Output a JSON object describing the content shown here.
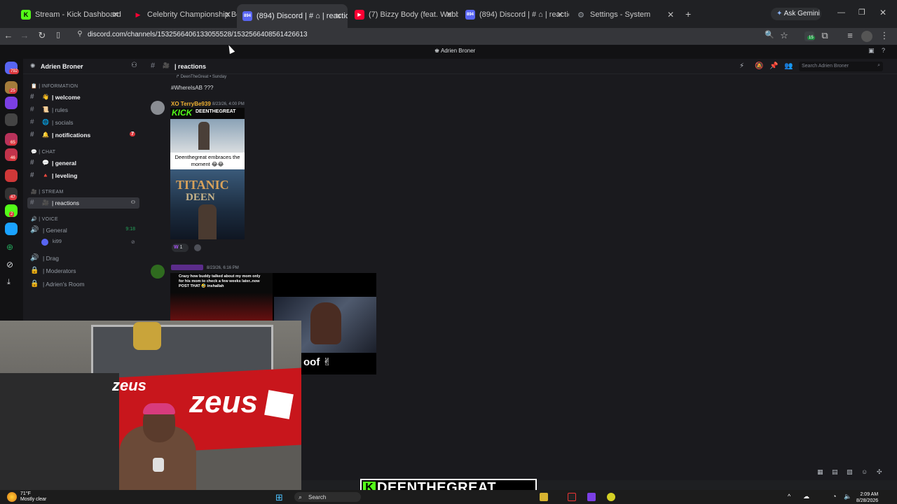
{
  "browser": {
    "tabs": [
      {
        "label": "Stream - Kick Dashboard",
        "favicon": "K",
        "color": "#53fc18"
      },
      {
        "label": "Celebrity Championship Box",
        "favicon": "▶",
        "color": "#ff0033"
      },
      {
        "label": "(894) Discord | # ⌂ | reactions",
        "favicon": "894",
        "color": "#5865f2"
      },
      {
        "label": "(7) Bizzy Body (feat. Webbie &",
        "favicon": "▶",
        "color": "#ff0033"
      },
      {
        "label": "(894) Discord | # ⌂ | reactions",
        "favicon": "894",
        "color": "#5865f2"
      },
      {
        "label": "Settings - System",
        "favicon": "⚙",
        "color": "#9aa0a6"
      }
    ],
    "ask_gemini": "Ask Gemini",
    "url": "discord.com/channels/1532566406133055528/1532566408561426613",
    "extension_badge": "15"
  },
  "discord": {
    "guild_banner": "Adrien Broner",
    "server_name": "Adrien Broner",
    "server_rail_badges": [
      "792",
      "25",
      "65",
      "46",
      "47",
      "2"
    ],
    "categories": {
      "information": "| INFORMATION",
      "chat": "| CHAT",
      "stream": "| STREAM",
      "voice": "| VOICE"
    },
    "channels": [
      {
        "emoji": "👋",
        "label": "| welcome",
        "bright": true
      },
      {
        "emoji": "📜",
        "label": "| rules",
        "bright": false
      },
      {
        "emoji": "🌐",
        "label": "| socials",
        "bright": false
      },
      {
        "emoji": "🔔",
        "label": "| notifications",
        "bright": true,
        "badge": "7"
      },
      {
        "emoji": "💬",
        "label": "| general",
        "bright": true
      },
      {
        "emoji": "🔺",
        "label": "| leveling",
        "bright": true
      },
      {
        "emoji": "🎥",
        "label": "| reactions",
        "selected": true
      }
    ],
    "voice": [
      {
        "label": "| General",
        "time": "9:18"
      },
      {
        "label": "| Drag"
      },
      {
        "label": "| Moderators"
      },
      {
        "label": "| Adrien's Room"
      }
    ],
    "voice_user": "ki99",
    "channel_title": "| reactions",
    "search_placeholder": "Search Adrien Broner",
    "messages": {
      "reply_author": "DeenTheGreat",
      "reply_time": "Sunday",
      "top_text": "#WhereIsAB ???",
      "m1": {
        "author": "XO TerryBe939",
        "timestamp": "8/23/26, 4:00 PM",
        "kick_logo": "KICK",
        "kick_name": "DEENTHEGREAT",
        "caption": "Deenthegreat embraces the moment 😂😂",
        "poster_title": "TITANIC",
        "poster_sub": "DEEN",
        "reaction": "1"
      },
      "m2": {
        "timestamp": "8/23/26, 6:16 PM",
        "caption": "Crazy how buddy talked about my mom only for his mom to check a few weeks later..now POST THAT 🤣 inshallah",
        "overlay": "oof ✌"
      }
    }
  },
  "watermark": {
    "name": "DEENTHEGREAT",
    "logo": "K"
  },
  "taskbar": {
    "temp": "71°F",
    "weather": "Mostly clear",
    "search": "Search",
    "time": "2:09 AM",
    "date": "8/28/2026"
  }
}
